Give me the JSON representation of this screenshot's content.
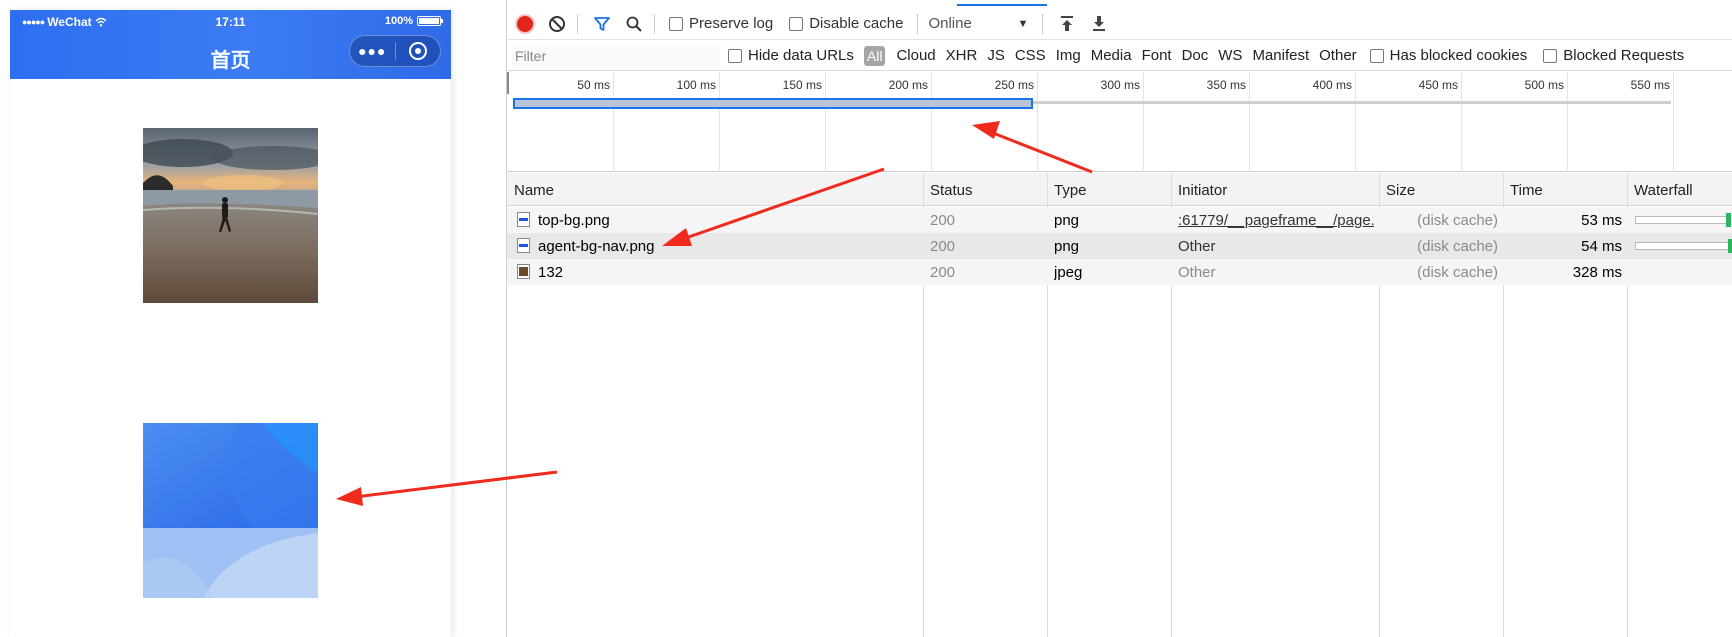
{
  "phone": {
    "status": {
      "carrier": "WeChat",
      "time": "17:11",
      "battery": "100%"
    },
    "nav_title": "首页"
  },
  "toolbar": {
    "preserve_log": "Preserve log",
    "disable_cache": "Disable cache",
    "throttling": "Online"
  },
  "filterbar": {
    "filter_placeholder": "Filter",
    "hide_data_urls": "Hide data URLs",
    "types": [
      "All",
      "Cloud",
      "XHR",
      "JS",
      "CSS",
      "Img",
      "Media",
      "Font",
      "Doc",
      "WS",
      "Manifest",
      "Other"
    ],
    "has_blocked_cookies": "Has blocked cookies",
    "blocked_requests": "Blocked Requests"
  },
  "overview": {
    "ticks": [
      "50 ms",
      "100 ms",
      "150 ms",
      "200 ms",
      "250 ms",
      "300 ms",
      "350 ms",
      "400 ms",
      "450 ms",
      "500 ms",
      "550 ms"
    ]
  },
  "table": {
    "columns": [
      "Name",
      "Status",
      "Type",
      "Initiator",
      "Size",
      "Time",
      "Waterfall"
    ],
    "rows": [
      {
        "name": "top-bg.png",
        "status": "200",
        "type": "png",
        "initiator": ":61779/__pageframe__/page...",
        "size": "(disk cache)",
        "time": "53 ms",
        "icon": "png-file-icon"
      },
      {
        "name": "agent-bg-nav.png",
        "status": "200",
        "type": "png",
        "initiator": "Other",
        "size": "(disk cache)",
        "time": "54 ms",
        "icon": "png-file-icon"
      },
      {
        "name": "132",
        "status": "200",
        "type": "jpeg",
        "initiator": "Other",
        "size": "(disk cache)",
        "time": "328 ms",
        "icon": "image-file-icon"
      }
    ]
  },
  "colors": {
    "record": "#e3261d",
    "accent": "#1a73e8",
    "annotation": "#f02a1d",
    "header_blue": "#2e6ef0"
  }
}
